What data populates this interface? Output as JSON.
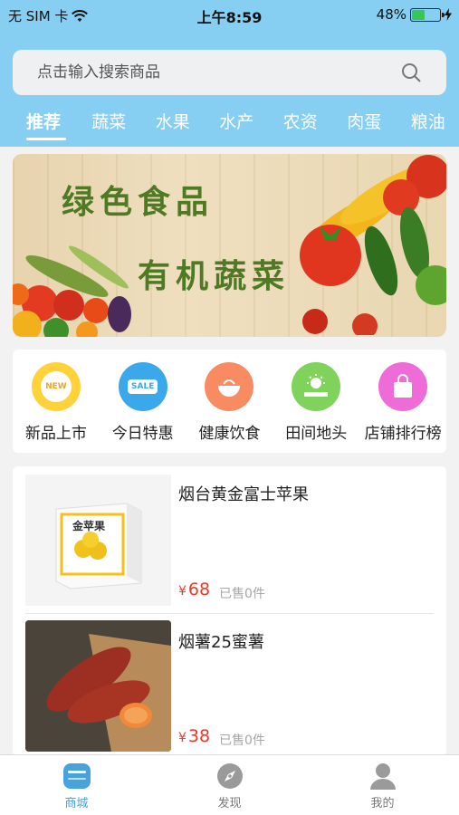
{
  "status_bar": {
    "carrier": "无 SIM 卡",
    "time": "上午8:59",
    "battery_text": "48%",
    "battery_level": 0.48
  },
  "search": {
    "placeholder": "点击输入搜索商品",
    "icon": "search-icon"
  },
  "tabs": [
    {
      "label": "推荐",
      "active": true
    },
    {
      "label": "蔬菜"
    },
    {
      "label": "水果"
    },
    {
      "label": "水产"
    },
    {
      "label": "农资"
    },
    {
      "label": "肉蛋"
    },
    {
      "label": "粮油"
    }
  ],
  "banner": {
    "line1": "绿色食品",
    "line2": "有机蔬菜"
  },
  "categories": [
    {
      "label": "新品上市",
      "icon": "new-badge-icon",
      "badge": "NEW",
      "color": "#ffd23a"
    },
    {
      "label": "今日特惠",
      "icon": "sale-tag-icon",
      "badge": "SALE",
      "color": "#3aa8ea"
    },
    {
      "label": "健康饮食",
      "icon": "food-bowl-icon",
      "badge": "",
      "color": "#f98b63"
    },
    {
      "label": "田间地头",
      "icon": "sun-field-icon",
      "badge": "",
      "color": "#7fd35a"
    },
    {
      "label": "店铺排行榜",
      "icon": "shopping-bag-icon",
      "badge": "",
      "color": "#ee6bd8"
    }
  ],
  "products": [
    {
      "name": "烟台黄金富士苹果",
      "currency": "¥",
      "price": "68",
      "sold": "已售0件",
      "box_label": "金苹果"
    },
    {
      "name": "烟薯25蜜薯",
      "currency": "¥",
      "price": "38",
      "sold": "已售0件"
    }
  ],
  "bottom_nav": [
    {
      "label": "商城",
      "icon": "shop-icon",
      "active": true
    },
    {
      "label": "发现",
      "icon": "compass-icon"
    },
    {
      "label": "我的",
      "icon": "user-icon"
    }
  ],
  "colors": {
    "header_bg": "#87cff2",
    "accent": "#48a3dd",
    "price": "#e63a2a"
  }
}
